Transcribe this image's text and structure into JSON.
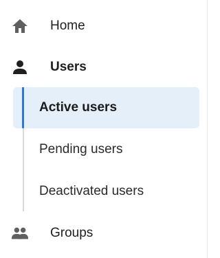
{
  "nav": {
    "home": {
      "label": "Home",
      "icon": "home-icon"
    },
    "users": {
      "label": "Users",
      "icon": "person-icon",
      "subitems": [
        {
          "label": "Active users",
          "active": true
        },
        {
          "label": "Pending users",
          "active": false
        },
        {
          "label": "Deactivated users",
          "active": false
        }
      ]
    },
    "groups": {
      "label": "Groups",
      "icon": "groups-icon"
    }
  },
  "colors": {
    "active_background": "#e5eff9",
    "active_indicator": "#2f76d2",
    "icon": "#5f5f5f",
    "users_icon": "#1f1f1f"
  }
}
